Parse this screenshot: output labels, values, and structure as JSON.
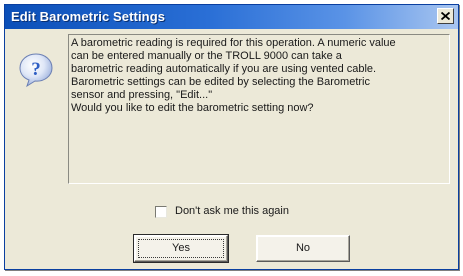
{
  "window": {
    "title": "Edit Barometric Settings"
  },
  "icons": {
    "close": "close-icon",
    "message": "question-icon"
  },
  "message": {
    "lines": [
      "A barometric reading is required for this operation. A numeric value",
      "can be entered manually or the TROLL 9000 can take a",
      "barometric reading automatically if you are using vented cable.",
      "Barometric settings can be edited by selecting the Barometric",
      "sensor and pressing, \"Edit...\"",
      "Would you like to edit the barometric setting now?"
    ]
  },
  "checkbox": {
    "label": "Don't ask me this again",
    "checked": false
  },
  "buttons": {
    "yes": "Yes",
    "no": "No"
  },
  "colors": {
    "titlebar": "#0b4fb8",
    "dialog_face": "#ece9d8",
    "icon_blue": "#2f5fc4"
  }
}
